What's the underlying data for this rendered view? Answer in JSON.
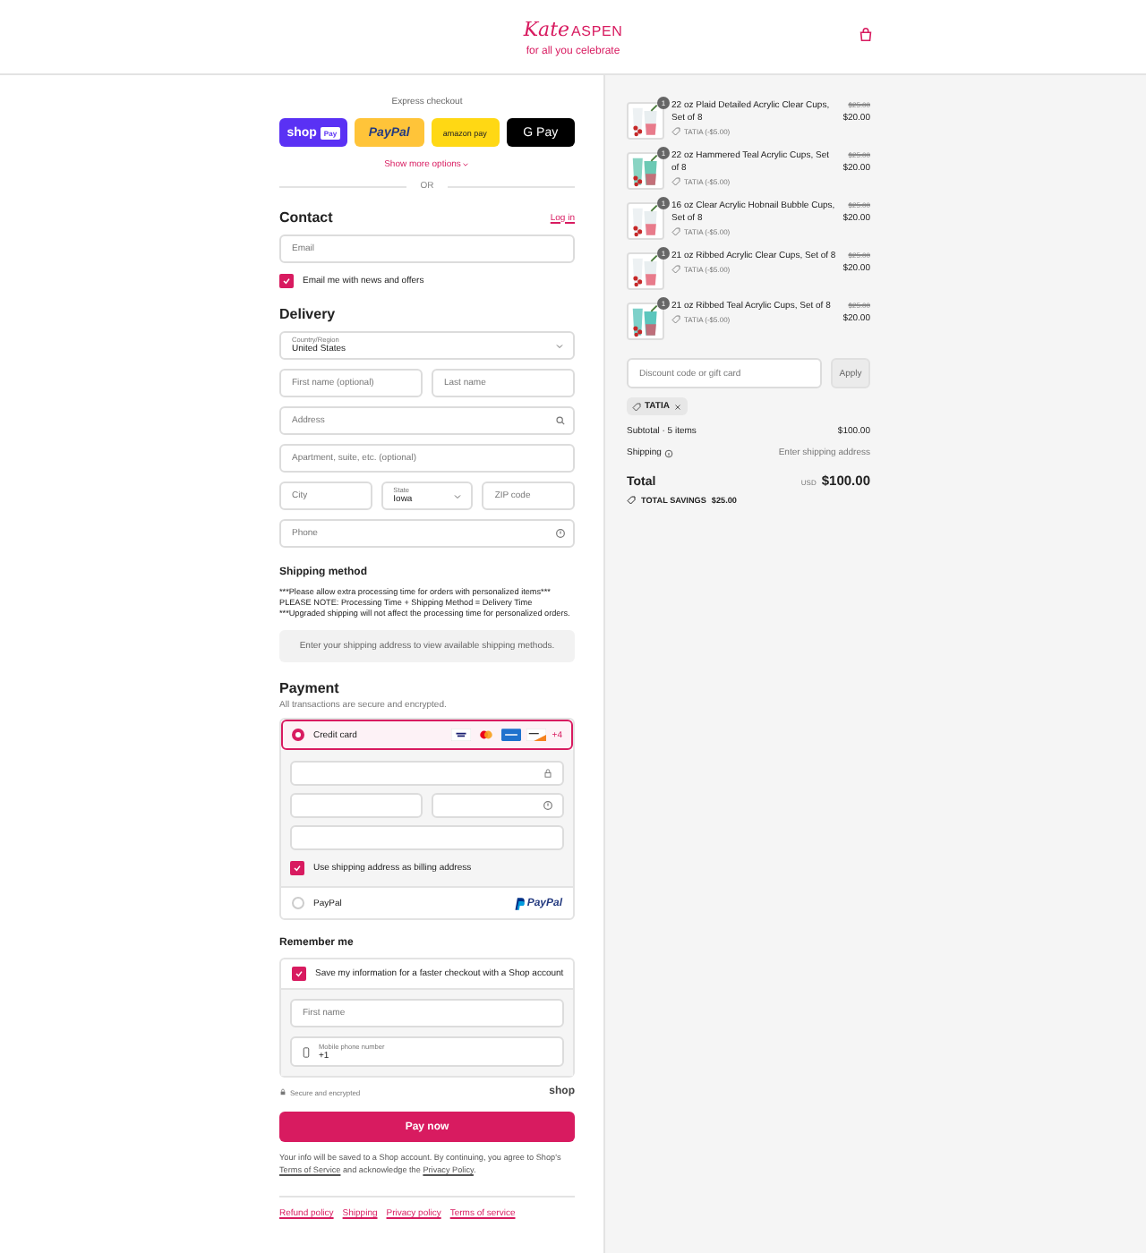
{
  "header": {
    "brand_script": "Kate",
    "brand": "ASPEN",
    "tagline": "for all you celebrate"
  },
  "express_checkout": {
    "title": "Express checkout",
    "buttons": [
      {
        "kind": "shop",
        "label": "shop",
        "badge": "Pay"
      },
      {
        "kind": "paypal",
        "label": "PayPal"
      },
      {
        "kind": "amazon",
        "label": "amazon pay"
      },
      {
        "kind": "gpay",
        "label": "G Pay"
      }
    ],
    "show_more": "Show more options",
    "divider": "OR"
  },
  "contact": {
    "title": "Contact",
    "login": "Log in",
    "email": {
      "placeholder": "Email"
    },
    "newsletter": {
      "label": "Email me with news and offers",
      "checked": true
    }
  },
  "delivery": {
    "title": "Delivery",
    "country": {
      "label": "Country/Region",
      "value": "United States"
    },
    "first_name": {
      "placeholder": "First name (optional)"
    },
    "last_name": {
      "placeholder": "Last name"
    },
    "address": {
      "placeholder": "Address"
    },
    "apartment": {
      "placeholder": "Apartment, suite, etc. (optional)"
    },
    "city": {
      "placeholder": "City"
    },
    "state": {
      "label": "State",
      "value": "Iowa"
    },
    "zip": {
      "placeholder": "ZIP code"
    },
    "phone": {
      "placeholder": "Phone"
    }
  },
  "shipping_method": {
    "title": "Shipping method",
    "notes": [
      "***Please allow extra processing time for orders with personalized items***",
      "PLEASE NOTE: Processing Time + Shipping Method = Delivery Time",
      "***Upgraded shipping will not affect the processing time for personalized orders."
    ],
    "notice": "Enter your shipping address to view available shipping methods."
  },
  "payment": {
    "title": "Payment",
    "subtitle": "All transactions are secure and encrypted.",
    "methods": [
      {
        "kind": "card",
        "label": "Credit card",
        "selected": true,
        "more_cards": "+4",
        "billing_same": {
          "label": "Use shipping address as billing address",
          "checked": true
        }
      },
      {
        "kind": "paypal",
        "label": "PayPal",
        "selected": false,
        "logo": "PayPal"
      }
    ]
  },
  "remember_me": {
    "title": "Remember me",
    "save": {
      "label": "Save my information for a faster checkout with a Shop account",
      "checked": true
    },
    "first_name": {
      "placeholder": "First name"
    },
    "mobile": {
      "label": "Mobile phone number",
      "value": "+1"
    },
    "secure": "Secure and encrypted",
    "shop_logo": "shop"
  },
  "pay_button": "Pay now",
  "legal": {
    "before": "Your info will be saved to a Shop account. By continuing, you agree to Shop's",
    "terms": "Terms of Service",
    "middle": "and acknowledge the",
    "privacy": "Privacy Policy",
    "after": "."
  },
  "footer_links": [
    "Refund policy",
    "Shipping",
    "Privacy policy",
    "Terms of service"
  ],
  "order": {
    "items": [
      {
        "name": "22 oz Plaid Detailed Acrylic Clear Cups, Set of 8",
        "quantity": "1",
        "discount": "TATIA (-$5.00)",
        "old_price": "$25.00",
        "price": "$20.00"
      },
      {
        "name": "22 oz Hammered Teal Acrylic Cups, Set of 8",
        "quantity": "1",
        "discount": "TATIA (-$5.00)",
        "old_price": "$25.00",
        "price": "$20.00"
      },
      {
        "name": "16 oz Clear Acrylic Hobnail Bubble Cups, Set of 8",
        "quantity": "1",
        "discount": "TATIA (-$5.00)",
        "old_price": "$25.00",
        "price": "$20.00"
      },
      {
        "name": "21 oz Ribbed Acrylic Clear Cups, Set of 8",
        "quantity": "1",
        "discount": "TATIA (-$5.00)",
        "old_price": "$25.00",
        "price": "$20.00"
      },
      {
        "name": "21 oz Ribbed Teal Acrylic Cups, Set of 8",
        "quantity": "1",
        "discount": "TATIA (-$5.00)",
        "old_price": "$25.00",
        "price": "$20.00"
      }
    ],
    "discount_code": {
      "placeholder": "Discount code or gift card"
    },
    "apply": "Apply",
    "applied_code": "TATIA",
    "subtotal": {
      "label": "Subtotal · 5 items",
      "value": "$100.00"
    },
    "shipping": {
      "label": "Shipping",
      "value": "Enter shipping address"
    },
    "total": {
      "label": "Total",
      "currency": "USD",
      "value": "$100.00"
    },
    "savings": {
      "label": "TOTAL SAVINGS",
      "value": "$25.00"
    }
  }
}
